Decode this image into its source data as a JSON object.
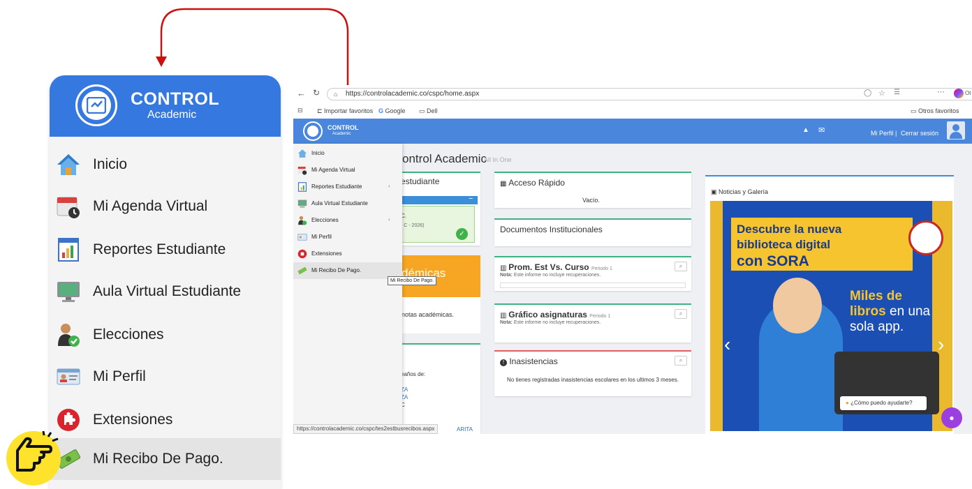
{
  "colors": {
    "accent": "#3478e0",
    "card_green": "#3fb37f",
    "card_red": "#e06060",
    "arrow": "#cc1010",
    "hand_badge": "#ffe22b",
    "banner_blue": "#1b4fb4",
    "banner_yellow": "#f5c42e"
  },
  "zoom_panel": {
    "logo_title": "CONTROL",
    "logo_subtitle": "Academic",
    "items": [
      {
        "label": "Inicio",
        "icon": "home-icon"
      },
      {
        "label": "Mi Agenda Virtual",
        "icon": "calendar-clock-icon"
      },
      {
        "label": "Reportes Estudiante",
        "icon": "report-chart-icon"
      },
      {
        "label": "Aula Virtual Estudiante",
        "icon": "monitor-icon"
      },
      {
        "label": "Elecciones",
        "icon": "voter-icon"
      },
      {
        "label": "Mi Perfil",
        "icon": "id-card-icon"
      },
      {
        "label": "Extensiones",
        "icon": "puzzle-icon"
      },
      {
        "label": "Mi Recibo De Pago.",
        "icon": "money-bill-icon",
        "active": true
      }
    ]
  },
  "browser": {
    "url": "https://controlacademic.co/cspc/home.aspx",
    "bookmarks": [
      "Importar favoritos",
      "Google",
      "Dell"
    ],
    "bookmarks_other": "Otros favoritos",
    "profile_short": "Ot"
  },
  "app": {
    "logo_title": "CONTROL",
    "logo_subtitle": "Academic",
    "profile_link": "Mi Perfil",
    "separator": "|",
    "logout_link": "Cerrar sesión",
    "page_title": "ontrol Academic",
    "page_subtitle": "All In One"
  },
  "menu": {
    "items": [
      {
        "label": "Inicio",
        "has_submenu": false
      },
      {
        "label": "Mi Agenda Virtual",
        "has_submenu": false
      },
      {
        "label": "Reportes Estudiante",
        "has_submenu": true
      },
      {
        "label": "Aula Virtual Estudiante",
        "has_submenu": false
      },
      {
        "label": "Elecciones",
        "has_submenu": true
      },
      {
        "label": "Mi Perfil",
        "has_submenu": false
      },
      {
        "label": "Extensiones",
        "has_submenu": false
      },
      {
        "label": "Mi Recibo De Pago.",
        "has_submenu": false,
        "active": true
      }
    ],
    "chevron": "‹",
    "tooltip": "Mi Recibo De Pago."
  },
  "left_cards": {
    "student_title": "estudiante",
    "student_collapse": "−",
    "student_line1": "C.",
    "student_line2": "- C - 2026)",
    "academic_title": "démicas",
    "notes_text": "notas académicas.",
    "birthdays_label": "eaños de:",
    "birthdays": [
      "ZA",
      "ZA",
      "C"
    ],
    "bottom_name": "ARITA"
  },
  "cards": {
    "quick_access_title": "Acceso Rápido",
    "quick_access_value": "Vacío.",
    "docs_title": "Documentos Institucionales",
    "prom_title": "Prom. Est Vs. Curso",
    "prom_period": "Periodo 1",
    "prom_note_label": "Nota:",
    "prom_note": "Este informe no incluye recuperaciones.",
    "graf_title": "Gráfico asignaturas",
    "graf_period": "Periodo 1",
    "graf_note_label": "Nota:",
    "graf_note": "Este informe no incluye recuperaciones.",
    "absences_title": "Inasistencias",
    "absences_text": "No tienes registradas inasistencias escolares en los ultimos 3 meses."
  },
  "news": {
    "title": "Noticias y Galería",
    "banner_line1": "Descubre la nueva",
    "banner_line2": "biblioteca digital",
    "banner_line3": "con SORA",
    "banner_b1": "Miles de",
    "banner_b2a": "libros",
    "banner_b2b": " en una",
    "banner_b3": "sola app.",
    "prev": "‹",
    "next": "›"
  },
  "chat": {
    "prompt": "¿Cómo puedo ayudarte?"
  },
  "status_url": "https://controlacademic.co/cspc/tes2estbusrecibos.aspx"
}
